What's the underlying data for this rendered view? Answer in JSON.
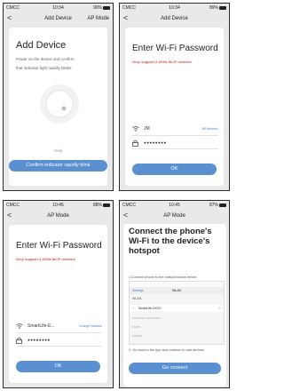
{
  "screens": [
    {
      "status": {
        "carrier": "CMCC",
        "time": "10:34",
        "battery": "90%"
      },
      "nav": {
        "back": "<",
        "title": "Add Device",
        "right": "AP Mode"
      },
      "heading": "Add Device",
      "instructions": [
        "Power on the device and confirm",
        "that indicator light rapidly blinks"
      ],
      "help_label": "Help",
      "confirm_label": "Confirm indicator rapidly blink"
    },
    {
      "status": {
        "carrier": "CMCC",
        "time": "10:34",
        "battery": "89%"
      },
      "nav": {
        "back": "<",
        "title": "Add Device"
      },
      "heading": "Enter Wi-Fi Password",
      "warning": "Only support 2.4GHz Wi-Fi network",
      "wifi_name": "JM",
      "wifi_link": "JM Network",
      "password": "●●●●●●●●",
      "ok_label": "OK"
    },
    {
      "status": {
        "carrier": "CMCC",
        "time": "10:45",
        "battery": "88%"
      },
      "nav": {
        "back": "<",
        "title": "AP Mode"
      },
      "heading": "Enter Wi-Fi Password",
      "warning": "Only support 2.4GHz Wi-Fi network",
      "wifi_name": "SmartLife-E...",
      "wifi_link": "Change Network",
      "password": "●●●●●●●●",
      "ok_label": "OK"
    },
    {
      "status": {
        "carrier": "CMCC",
        "time": "10:45",
        "battery": "87%"
      },
      "nav": {
        "back": "<",
        "title": "AP Mode"
      },
      "heading": [
        "Connect the phone's",
        "Wi-Fi to the device's",
        "hotspot"
      ],
      "step1": "1.Connect phone to the hotspot shown below",
      "panel": {
        "back": "Settings",
        "wlan": "WLAN",
        "rows": [
          "WLAN",
          "SmartLife-XXXX",
          "CHOOSE A NETWORK...",
          "Home",
          "hotwrd"
        ]
      },
      "step2": "2. Go back to the App and continue to add devices",
      "go_label": "Go connect"
    }
  ]
}
